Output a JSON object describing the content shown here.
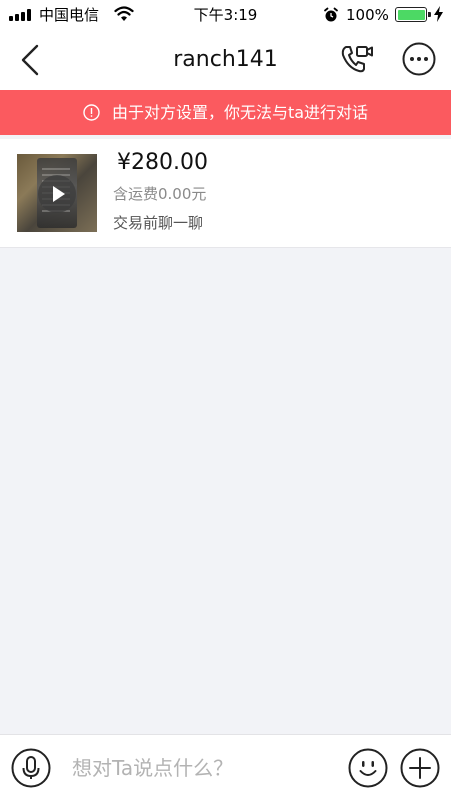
{
  "status_bar": {
    "carrier": "中国电信",
    "time": "下午3:19",
    "battery_percent": "100%",
    "icons": [
      "signal-icon",
      "wifi-icon",
      "alarm-icon",
      "battery-icon",
      "charging-icon"
    ]
  },
  "nav": {
    "title": "ranch141",
    "icons": [
      "back-arrow-icon",
      "video-call-icon",
      "more-icon"
    ]
  },
  "banner": {
    "text": "由于对方设置，你无法与ta进行对话",
    "icon": "info-icon",
    "color": "#fb5a5f"
  },
  "product": {
    "price": "¥280.00",
    "shipping": "含运费0.00元",
    "chat_hint": "交易前聊一聊",
    "thumbnail_icon": "play-icon"
  },
  "input_bar": {
    "placeholder": "想对Ta说点什么？",
    "value": "",
    "icons": [
      "microphone-icon",
      "emoji-icon",
      "plus-icon"
    ]
  }
}
